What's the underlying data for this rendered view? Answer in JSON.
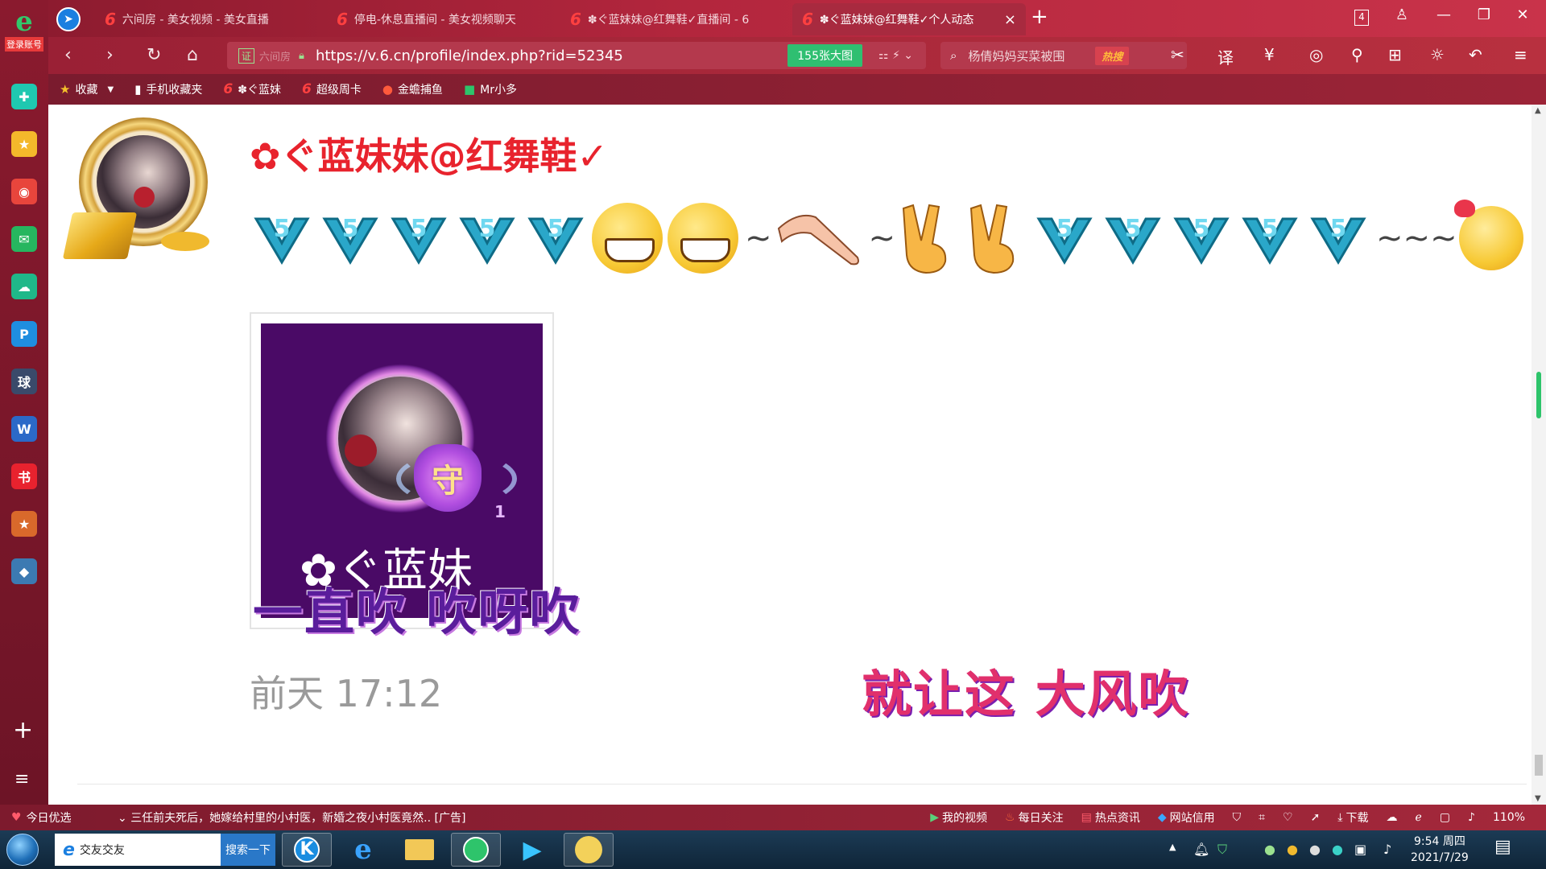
{
  "browser": {
    "tabs": [
      {
        "label": "六间房 - 美女视频 - 美女直播",
        "active": false
      },
      {
        "label": "停电-休息直播间 - 美女视频聊天",
        "active": false
      },
      {
        "label": "✽ぐ蓝妹妹@红舞鞋✓直播间 - 6",
        "active": false
      },
      {
        "label": "✽ぐ蓝妹妹@红舞鞋✓个人动态",
        "active": true
      }
    ],
    "tab_count": "4",
    "new_tab": "+",
    "url": "https://v.6.cn/profile/index.php?rid=52345",
    "url_badge": "证",
    "url_site": "六间房",
    "image_count": "155张大图",
    "search_text": "杨倩妈妈买菜被围",
    "hot_badge": "热搜",
    "bookmarks": [
      "收藏",
      "手机收藏夹",
      "✽ぐ蓝妹",
      "超级周卡",
      "金蟾捕鱼",
      "Mr小多"
    ]
  },
  "sidebar": {
    "logo_letter": "e",
    "login_label": "登录账号",
    "apps": [
      {
        "name": "add-circle-app-icon",
        "color": "#1fc8b0",
        "glyph": "✚"
      },
      {
        "name": "star-app-icon",
        "color": "#f4b82b",
        "glyph": "★"
      },
      {
        "name": "weibo-app-icon",
        "color": "#e8453c",
        "glyph": "◉"
      },
      {
        "name": "mail-app-icon",
        "color": "#26b65f",
        "glyph": "✉"
      },
      {
        "name": "cloud-app-icon",
        "color": "#1fb889",
        "glyph": "☁"
      },
      {
        "name": "p-app-icon",
        "color": "#1f8ee0",
        "glyph": "P"
      },
      {
        "name": "news-app-icon",
        "color": "#3a4a6a",
        "glyph": "球"
      },
      {
        "name": "word-app-icon",
        "color": "#2b69c8",
        "glyph": "W"
      },
      {
        "name": "xiaohongshu-app-icon",
        "color": "#e8222e",
        "glyph": "书"
      },
      {
        "name": "game-app-icon",
        "color": "#d9692b",
        "glyph": "★"
      },
      {
        "name": "game2-app-icon",
        "color": "#3c7ab2",
        "glyph": "◆"
      }
    ],
    "add_label": "+",
    "menu_label": "≡"
  },
  "profile": {
    "name": "✿ぐ蓝妹妹@红舞鞋✓",
    "post_image_name": "✿ぐ蓝妹",
    "post_image_badge": "守",
    "post_image_level": "1",
    "post_time": "前天 17:12",
    "tildes": [
      "~",
      "~",
      "~~~"
    ]
  },
  "danmaku": [
    "一直吹  吹呀吹",
    "就让这  大风吹"
  ],
  "statusbar": {
    "today_pick": "今日优选",
    "news": "三任前夫死后，她嫁给村里的小村医，新婚之夜小村医竟然..",
    "ad": "[广告]",
    "items": [
      "我的视频",
      "每日关注",
      "热点资讯",
      "网站信用"
    ],
    "download": "下载",
    "zoom": "110%"
  },
  "taskbar": {
    "search_text": "交友交友",
    "search_button": "搜索一下",
    "clock_time": "9:54 周四",
    "clock_date": "2021/7/29"
  },
  "colors": {
    "chrome_red": "#a82a3f",
    "name_red": "#e8232d",
    "accent_green": "#2fbf71"
  }
}
